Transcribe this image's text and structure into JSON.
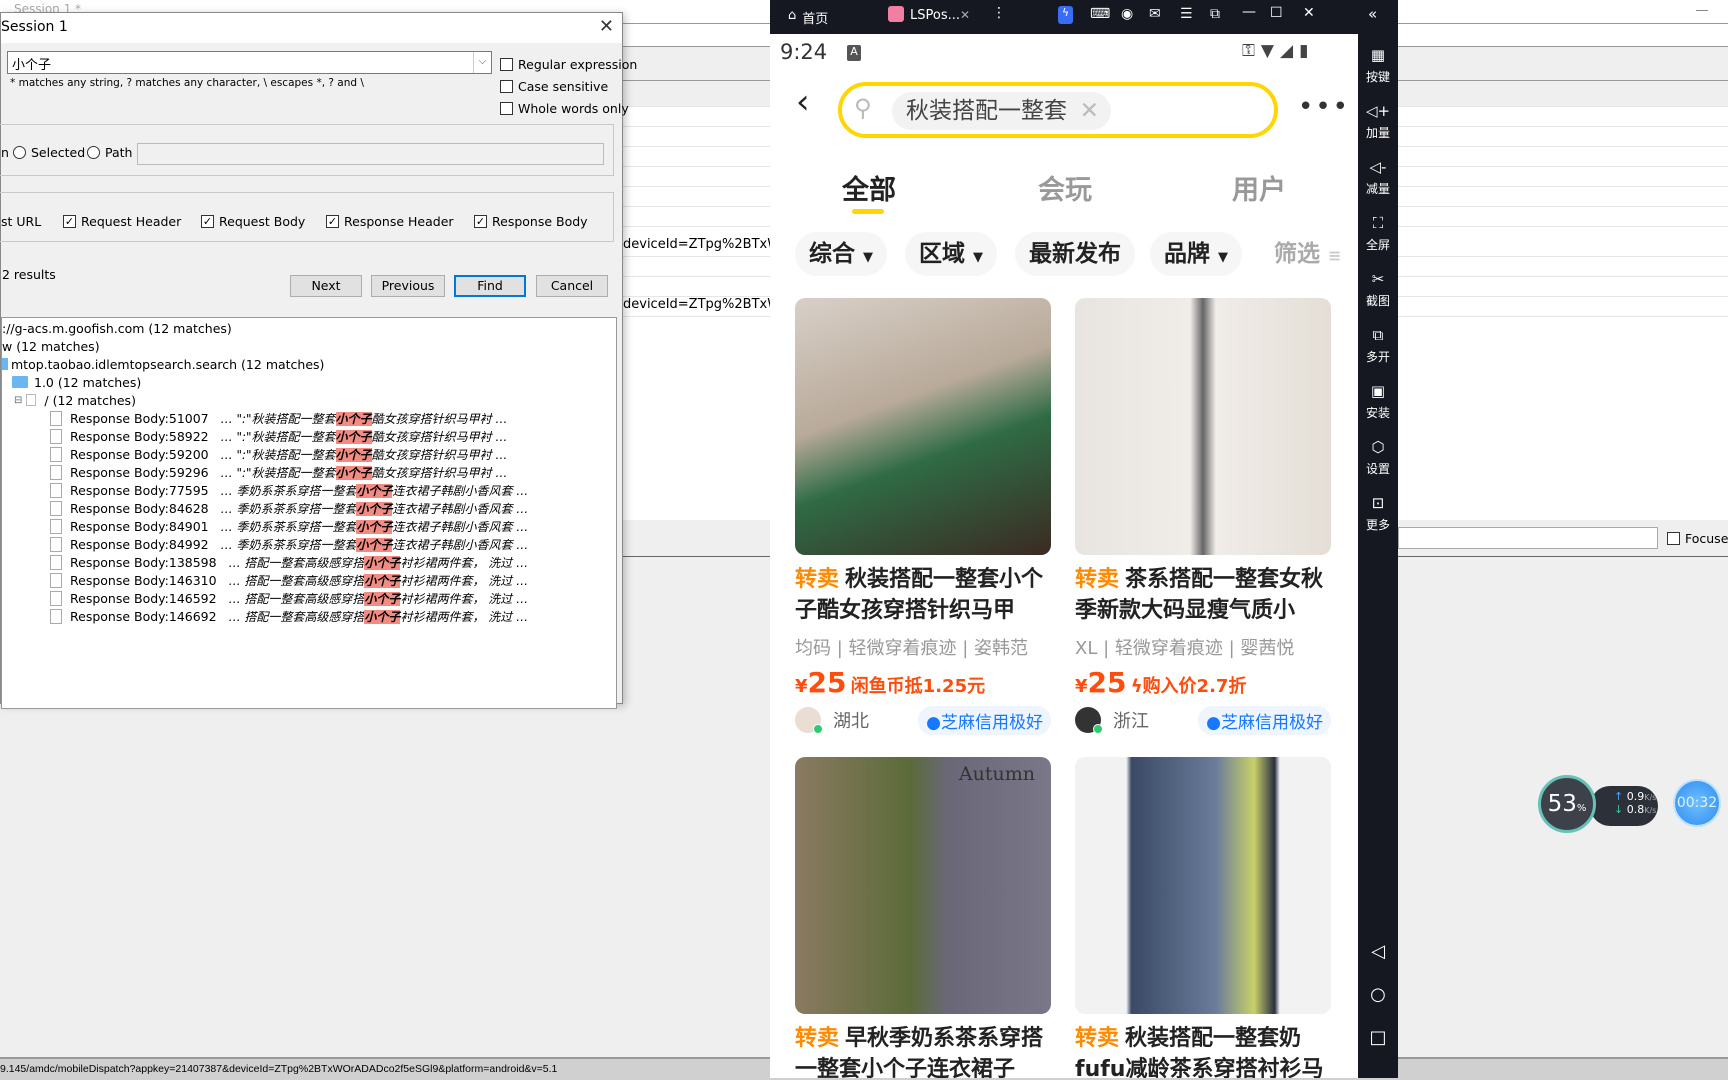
{
  "background": {
    "tab_title": "Session 1 *",
    "list_rows": [
      "deviceId=ZTpg%2BTxWOr",
      "deviceId=ZTpg%2BTxWOr"
    ],
    "focused_label": "Focused",
    "status_url": "9.145/amdc/mobileDispatch?appkey=21407387&deviceId=ZTpg%2BTxWOrADADco2f5eSGl9&platform=android&v=5.1"
  },
  "dialog": {
    "title": "Session 1",
    "search_value": "小个子",
    "hint": "* matches any string, ? matches any character, \\ escapes *, ? and \\",
    "options": [
      {
        "label": "Regular expression",
        "checked": false
      },
      {
        "label": "Case sensitive",
        "checked": false
      },
      {
        "label": "Whole words only",
        "checked": false
      }
    ],
    "scope_partial": "n",
    "scope_selected": "Selected",
    "scope_path": "Path",
    "path_value": "",
    "targets": [
      {
        "label": "st URL",
        "checked": null
      },
      {
        "label": "Request Header",
        "checked": true
      },
      {
        "label": "Request Body",
        "checked": true
      },
      {
        "label": "Response Header",
        "checked": true
      },
      {
        "label": "Response Body",
        "checked": true
      }
    ],
    "results_count": "2 results",
    "buttons": {
      "next": "Next",
      "previous": "Previous",
      "find": "Find",
      "cancel": "Cancel"
    },
    "tree": {
      "host": "://g-acs.m.goofish.com (12 matches)",
      "level1": "w (12 matches)",
      "api": "mtop.taobao.idlemtopsearch.search (12 matches)",
      "version": "1.0 (12 matches)",
      "path": "/ (12 matches)",
      "results": [
        {
          "label": "Response Body:51007",
          "pre": "… \":\"秋装搭配一整套",
          "match": "小个子",
          "post": "酷女孩穿搭针织马甲衬 …"
        },
        {
          "label": "Response Body:58922",
          "pre": "… \":\"秋装搭配一整套",
          "match": "小个子",
          "post": "酷女孩穿搭针织马甲衬 …"
        },
        {
          "label": "Response Body:59200",
          "pre": "… \":\"秋装搭配一整套",
          "match": "小个子",
          "post": "酷女孩穿搭针织马甲衬 …"
        },
        {
          "label": "Response Body:59296",
          "pre": "… \":\"秋装搭配一整套",
          "match": "小个子",
          "post": "酷女孩穿搭针织马甲衬 …"
        },
        {
          "label": "Response Body:77595",
          "pre": "… 季奶系茶系穿搭一整套",
          "match": "小个子",
          "post": "连衣裙子韩剧小香风套 …"
        },
        {
          "label": "Response Body:84628",
          "pre": "… 季奶系茶系穿搭一整套",
          "match": "小个子",
          "post": "连衣裙子韩剧小香风套 …"
        },
        {
          "label": "Response Body:84901",
          "pre": "… 季奶系茶系穿搭一整套",
          "match": "小个子",
          "post": "连衣裙子韩剧小香风套 …"
        },
        {
          "label": "Response Body:84992",
          "pre": "… 季奶系茶系穿搭一整套",
          "match": "小个子",
          "post": "连衣裙子韩剧小香风套 …"
        },
        {
          "label": "Response Body:138598",
          "pre": "… 搭配一整套高级感穿搭",
          "match": "小个子",
          "post": "衬衫裙两件套， 洗过 …"
        },
        {
          "label": "Response Body:146310",
          "pre": "… 搭配一整套高级感穿搭",
          "match": "小个子",
          "post": "衬衫裙两件套， 洗过 …"
        },
        {
          "label": "Response Body:146592",
          "pre": "… 搭配一整套高级感穿搭",
          "match": "小个子",
          "post": "衬衫裙两件套， 洗过 …"
        },
        {
          "label": "Response Body:146692",
          "pre": "… 搭配一整套高级感穿搭",
          "match": "小个子",
          "post": "衬衫裙两件套， 洗过 …"
        }
      ]
    }
  },
  "emulator": {
    "home_tab": "首页",
    "app_tab": "LSPos...",
    "sidebar": [
      "按键",
      "加量",
      "减量",
      "全屏",
      "截图",
      "多开",
      "安装",
      "设置",
      "更多"
    ],
    "widget": {
      "cpu": "53",
      "cpu_unit": "%",
      "up": "0.9",
      "down": "0.8",
      "rate_unit": "K/s",
      "timer": "00:32"
    }
  },
  "phone": {
    "time": "9:24",
    "search_query": "秋装搭配一整套",
    "tabs": [
      {
        "label": "全部",
        "active": true
      },
      {
        "label": "会玩",
        "active": false
      },
      {
        "label": "用户",
        "active": false
      }
    ],
    "filters": [
      "综合",
      "区域",
      "最新发布",
      "品牌",
      "筛选"
    ],
    "accent": "#ffd600",
    "products": [
      {
        "tag": "转卖",
        "title": "秋装搭配一整套小个子酷女孩穿搭针织马甲",
        "tags": [
          "均码",
          "轻微穿着痕迹",
          "姿韩范"
        ],
        "currency": "¥",
        "price": "25",
        "promo": "闲鱼币抵1.25元",
        "location": "湖北",
        "credit": "芝麻信用极好"
      },
      {
        "tag": "转卖",
        "title": "茶系搭配一整套女秋季新款大码显瘦气质小",
        "tags": [
          "XL",
          "轻微穿着痕迹",
          "婴茜悦"
        ],
        "currency": "¥",
        "price": "25",
        "promo": "购入价2.7折",
        "location": "浙江",
        "credit": "芝麻信用极好"
      },
      {
        "tag": "转卖",
        "title": "早秋季奶系茶系穿搭一整套小个子连衣裙子",
        "image_text": "Autumn"
      },
      {
        "tag": "转卖",
        "title": "秋装搭配一整套奶fufu减龄茶系穿搭衬衫马"
      }
    ]
  }
}
